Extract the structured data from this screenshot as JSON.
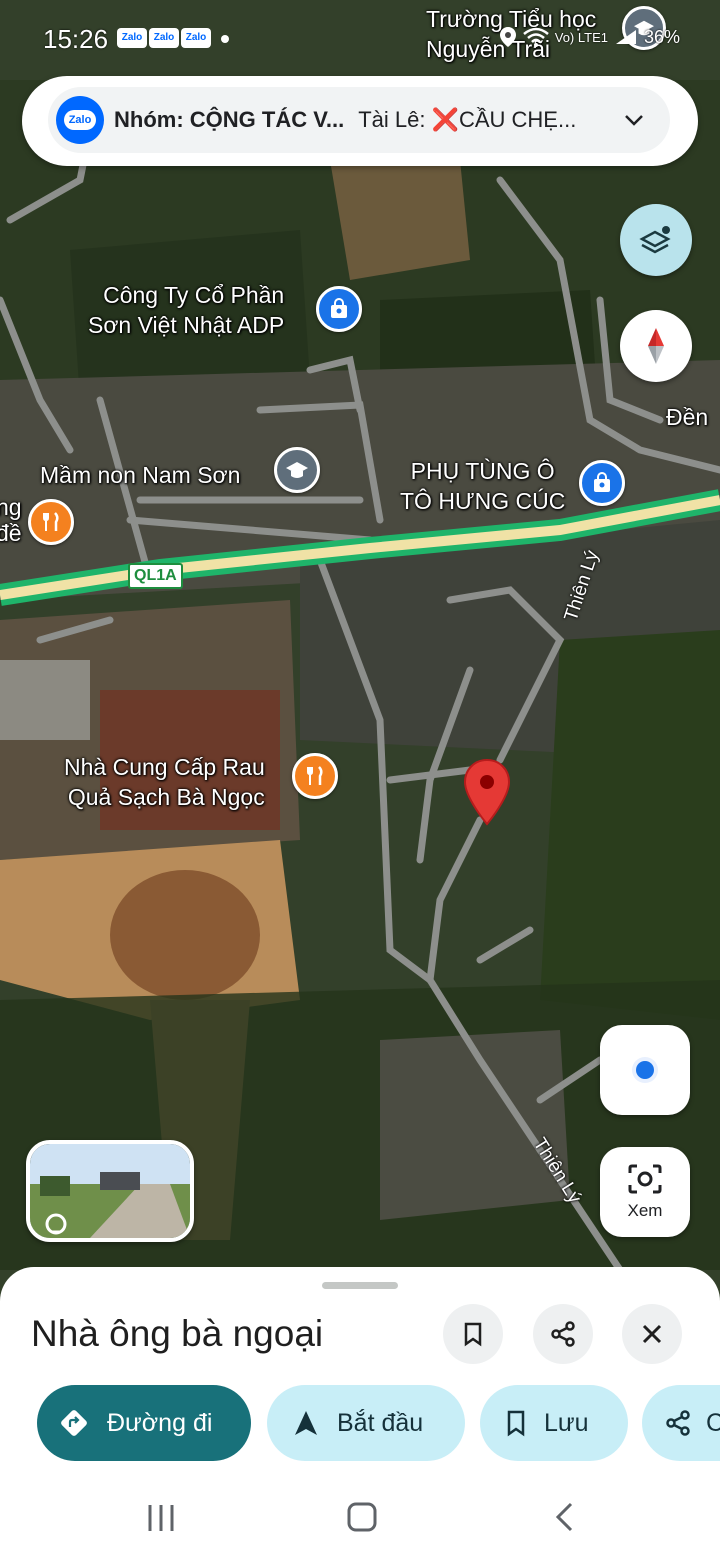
{
  "status_bar": {
    "time": "15:26",
    "notification_apps": [
      "Zalo",
      "Zalo",
      "Zalo"
    ],
    "signal_text": "Vo) LTE1",
    "battery": "36%"
  },
  "notification": {
    "app": "Zalo",
    "title": "Nhóm: CỘNG TÁC V...",
    "text": "Tài Lê: ❌CẦU CHẸ..."
  },
  "map": {
    "places": [
      {
        "name": "Trường Tiểu học\nNguyễn Trãi",
        "type": "school"
      },
      {
        "name": "Công Ty Cổ Phần\nSơn Việt Nhật ADP",
        "type": "shop"
      },
      {
        "name": "Mầm non Nam Sơn",
        "type": "school"
      },
      {
        "name": "PHỤ TÙNG Ô\nTÔ HƯNG CÚC",
        "type": "shop"
      },
      {
        "name": "Nhà Cung Cấp Rau\nQuả Sạch Bà Ngọc",
        "type": "food"
      },
      {
        "name": "Đền",
        "type": "label"
      },
      {
        "name": "ng\nđề",
        "type": "food"
      }
    ],
    "road_shield": "QL1A",
    "street_names": [
      "Thiên Lý",
      "Thiên Lý"
    ]
  },
  "controls": {
    "layers": "layers-icon",
    "compass": "compass-icon",
    "my_location": "my-location-icon",
    "lens_label": "Xem"
  },
  "sheet": {
    "title": "Nhà ông bà ngoại",
    "actions": {
      "directions": "Đường đi",
      "start": "Bắt đầu",
      "save": "Lưu",
      "share": "C"
    }
  },
  "colors": {
    "route": "#2ec27e",
    "directions_chip": "#18717a",
    "secondary_chip": "#c8eef7",
    "pin_red": "#e53935",
    "zalo_blue": "#0068ff"
  }
}
